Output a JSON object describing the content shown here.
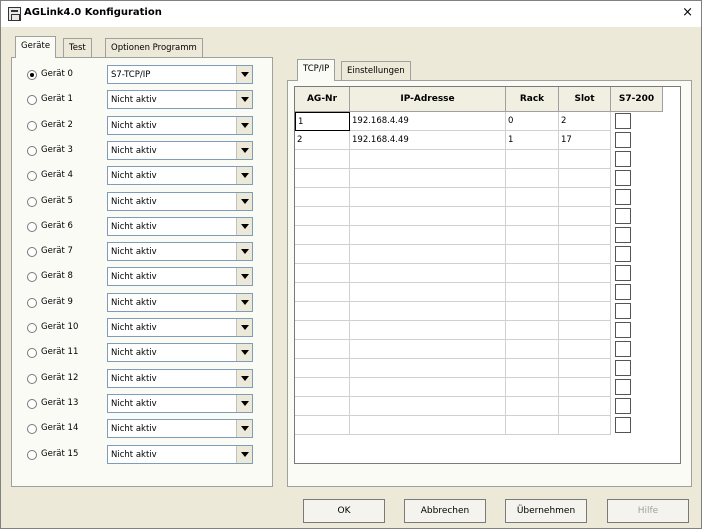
{
  "window": {
    "title": "AGLink4.0 Konfiguration",
    "close_glyph": "×"
  },
  "left_tabs": [
    "Geräte",
    "Test",
    "Optionen Programm"
  ],
  "devices": [
    {
      "label": "Gerät 0",
      "value": "S7-TCP/IP",
      "checked": true
    },
    {
      "label": "Gerät 1",
      "value": "Nicht aktiv"
    },
    {
      "label": "Gerät 2",
      "value": "Nicht aktiv"
    },
    {
      "label": "Gerät 3",
      "value": "Nicht aktiv"
    },
    {
      "label": "Gerät 4",
      "value": "Nicht aktiv"
    },
    {
      "label": "Gerät 5",
      "value": "Nicht aktiv"
    },
    {
      "label": "Gerät 6",
      "value": "Nicht aktiv"
    },
    {
      "label": "Gerät 7",
      "value": "Nicht aktiv"
    },
    {
      "label": "Gerät 8",
      "value": "Nicht aktiv"
    },
    {
      "label": "Gerät 9",
      "value": "Nicht aktiv"
    },
    {
      "label": "Gerät 10",
      "value": "Nicht aktiv"
    },
    {
      "label": "Gerät 11",
      "value": "Nicht aktiv"
    },
    {
      "label": "Gerät 12",
      "value": "Nicht aktiv"
    },
    {
      "label": "Gerät 13",
      "value": "Nicht aktiv"
    },
    {
      "label": "Gerät 14",
      "value": "Nicht aktiv"
    },
    {
      "label": "Gerät 15",
      "value": "Nicht aktiv"
    }
  ],
  "right_tabs": [
    "TCP/IP",
    "Einstellungen"
  ],
  "grid": {
    "headers": [
      "AG-Nr",
      "IP-Adresse",
      "Rack",
      "Slot",
      "S7-200"
    ],
    "rows": [
      {
        "ag": "1",
        "ip": "192.168.4.49",
        "rack": "0",
        "slot": "2",
        "s7_200": false
      },
      {
        "ag": "2",
        "ip": "192.168.4.49",
        "rack": "1",
        "slot": "17",
        "s7_200": false
      }
    ],
    "empty_rows": 15
  },
  "buttons": [
    {
      "label": "OK",
      "enabled": true
    },
    {
      "label": "Abbrechen",
      "enabled": true
    },
    {
      "label": "Übernehmen",
      "enabled": true
    },
    {
      "label": "Hilfe",
      "enabled": false
    }
  ]
}
